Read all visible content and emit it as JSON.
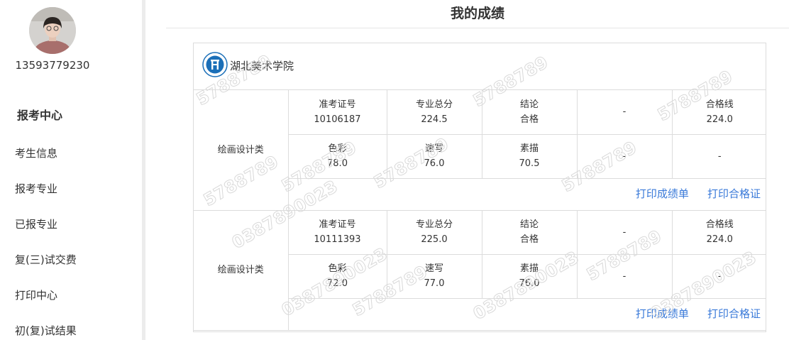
{
  "sidebar": {
    "phone": "13593779230",
    "menu_title": "报考中心",
    "items": [
      {
        "label": "考生信息"
      },
      {
        "label": "报考专业"
      },
      {
        "label": "已报专业"
      },
      {
        "label": "复(三)试交费"
      },
      {
        "label": "打印中心"
      },
      {
        "label": "初(复)试结果"
      }
    ]
  },
  "main": {
    "title": "我的成绩",
    "school_name": "湖北美术学院",
    "records": [
      {
        "category": "绘画设计类",
        "exam_no_label": "准考证号",
        "exam_no": "10106187",
        "total_label": "专业总分",
        "total": "224.5",
        "result_label": "结论",
        "result": "合格",
        "extra": "-",
        "pass_label": "合格线",
        "pass_line": "224.0",
        "color_label": "色彩",
        "color_score": "78.0",
        "sketch_label": "速写",
        "sketch_score": "76.0",
        "drawing_label": "素描",
        "drawing_score": "70.5",
        "empty1": "-",
        "empty2": "-",
        "print_grade": "打印成绩单",
        "print_cert": "打印合格证"
      },
      {
        "category": "绘画设计类",
        "exam_no_label": "准考证号",
        "exam_no": "10111393",
        "total_label": "专业总分",
        "total": "225.0",
        "result_label": "结论",
        "result": "合格",
        "extra": "-",
        "pass_label": "合格线",
        "pass_line": "224.0",
        "color_label": "色彩",
        "color_score": "72.0",
        "sketch_label": "速写",
        "sketch_score": "77.0",
        "drawing_label": "素描",
        "drawing_score": "76.0",
        "empty1": "-",
        "empty2": "-",
        "print_grade": "打印成绩单",
        "print_cert": "打印合格证"
      }
    ]
  },
  "watermark_text": "5788789",
  "watermark_text_2": "0387890023",
  "colors": {
    "link": "#3a7ad9",
    "border": "#dcdcdc",
    "school_logo": "#1b6fb8"
  }
}
